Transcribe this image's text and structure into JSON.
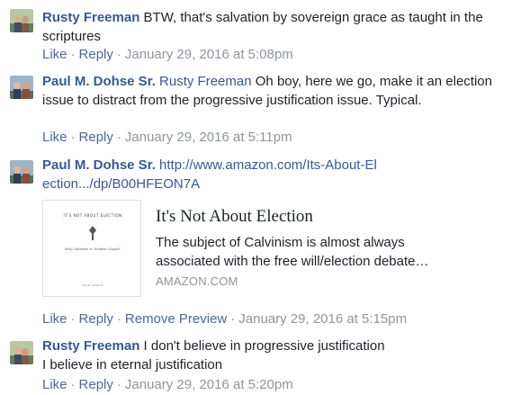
{
  "comments": [
    {
      "author": "Rusty Freeman",
      "tag": "",
      "text": "BTW, that's salvation by sovereign grace as taught in the scriptures",
      "actions": [
        "Like",
        "Reply"
      ],
      "timestamp": "January 29, 2016 at 5:08pm"
    },
    {
      "author": "Paul M. Dohse Sr.",
      "tag": "Rusty Freeman",
      "text": "Oh boy, here we go, make it an election issue to distract from the progressive justification issue. Typical.",
      "actions": [
        "Like",
        "Reply"
      ],
      "timestamp": "January 29, 2016 at 5:11pm"
    },
    {
      "author": "Paul M. Dohse Sr.",
      "link": "http://www.amazon.com/Its-About-Election.../dp/B00HFEON7A",
      "actions": [
        "Like",
        "Reply",
        "Remove Preview"
      ],
      "timestamp": "January 29, 2016 at 5:15pm"
    },
    {
      "author": "Rusty Freeman",
      "text_line1": "I don't believe in progressive justification",
      "text_line2": "I believe in eternal justification",
      "actions": [
        "Like",
        "Reply"
      ],
      "timestamp": "January 29, 2016 at 5:20pm"
    }
  ],
  "preview": {
    "title": "It's Not About Election",
    "description": "The subject of Calvinism is almost always associated with the free will/election debate…",
    "source": "AMAZON.COM",
    "thumb_title": "IT'S NOT ABOUT ELECTION",
    "thumb_subtitle": "Why Calvinism is \"Another Gospel\"",
    "thumb_footer": "Paul M. Dohse Sr."
  },
  "colors": {
    "link": "#365899",
    "meta": "#90949c",
    "action": "#4b67a1",
    "text": "#1d2129"
  }
}
